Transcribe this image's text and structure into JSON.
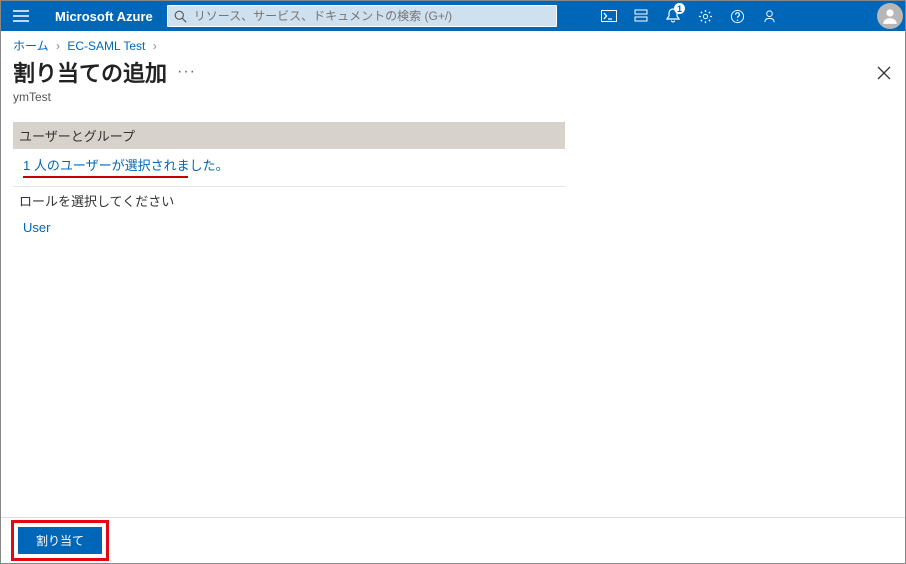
{
  "brand": "Microsoft Azure",
  "search": {
    "placeholder": "リソース、サービス、ドキュメントの検索 (G+/)"
  },
  "notifications": {
    "count": "1"
  },
  "breadcrumb": {
    "home": "ホーム",
    "app": "EC-SAML Test"
  },
  "page": {
    "title": "割り当ての追加",
    "subtitle": "ymTest"
  },
  "section": {
    "users_groups_label": "ユーザーとグループ",
    "users_selected": "1 人のユーザーが選択されました。",
    "role_label": "ロールを選択してください",
    "role_value": "User"
  },
  "footer": {
    "assign": "割り当て"
  }
}
